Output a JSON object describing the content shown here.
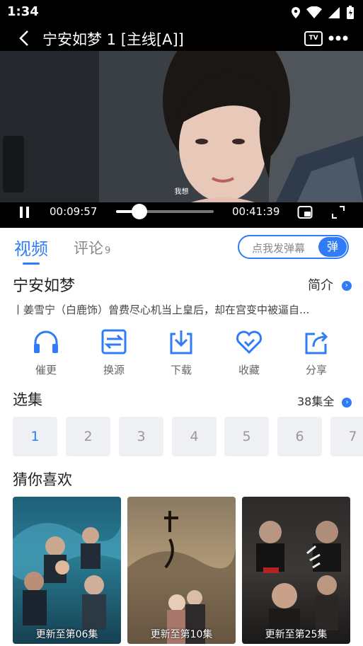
{
  "status": {
    "time": "1:34"
  },
  "header": {
    "title": "宁安如梦 1 [主线[A]]",
    "tv_label": "TV"
  },
  "player": {
    "subtitle": "我想",
    "current_time": "00:09:57",
    "total_time": "00:41:39",
    "progress": 0.24
  },
  "tabs": {
    "video": "视频",
    "comments": "评论",
    "comments_count": "9"
  },
  "danmaku": {
    "placeholder": "点我发弹幕",
    "button": "弹"
  },
  "show": {
    "title": "宁安如梦",
    "intro_label": "简介",
    "description": "丨姜雪宁（白鹿饰）曾费尽心机当上皇后，却在宫变中被逼自..."
  },
  "actions": [
    {
      "label": "催更",
      "icon": "headphones-icon"
    },
    {
      "label": "换源",
      "icon": "switch-source-icon"
    },
    {
      "label": "下载",
      "icon": "download-icon"
    },
    {
      "label": "收藏",
      "icon": "heart-icon"
    },
    {
      "label": "分享",
      "icon": "share-icon"
    }
  ],
  "episodes": {
    "title": "选集",
    "total": "38集全",
    "items": [
      "1",
      "2",
      "3",
      "4",
      "5",
      "6",
      "7"
    ],
    "selected": "1"
  },
  "recommend": {
    "title": "猜你喜欢",
    "items": [
      {
        "caption": "更新至第06集"
      },
      {
        "caption": "更新至第10集"
      },
      {
        "caption": "更新至第25集"
      }
    ]
  },
  "colors": {
    "accent": "#2f7cf6",
    "bar": "#000000"
  }
}
